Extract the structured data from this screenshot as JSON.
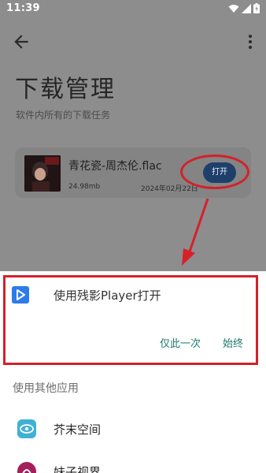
{
  "status_bar": {
    "time": "11:39",
    "icons": [
      "wifi-icon",
      "signal-icon",
      "battery-icon"
    ]
  },
  "toolbar": {
    "back_icon": "arrow-left-icon",
    "more_icon": "more-vert-icon"
  },
  "page": {
    "title": "下载管理",
    "subtitle": "软件内所有的下载任务"
  },
  "download_item": {
    "file_name": "青花瓷-周杰伦.flac",
    "size": "24.98mb",
    "date": "2024年02月22日",
    "open_label": "打开"
  },
  "chooser": {
    "suggested_title": "使用残影Player打开",
    "just_once_label": "仅此一次",
    "always_label": "始终",
    "other_apps_label": "使用其他应用",
    "apps": [
      {
        "label": "芥末空间",
        "icon": "jiemo-space-icon",
        "color": "#3fb1d6"
      },
      {
        "label": "妹子视界",
        "icon": "meizi-view-icon",
        "color": "#a61d5c"
      }
    ]
  },
  "colors": {
    "dim_overlay": "#8d8d8d",
    "highlight_red": "#d5202a",
    "accent_teal": "#1b7b6f",
    "open_button": "#1f3f6b"
  }
}
